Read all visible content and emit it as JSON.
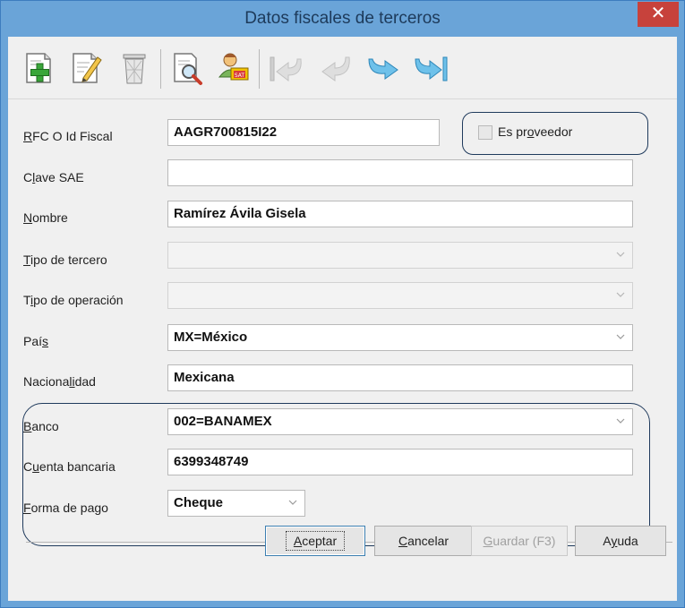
{
  "window": {
    "title": "Datos fiscales de terceros",
    "close_glyph": "✕"
  },
  "toolbar": {
    "buttons": [
      {
        "icon": "add-record-icon"
      },
      {
        "icon": "edit-record-icon"
      },
      {
        "icon": "delete-record-icon"
      },
      {
        "icon": "search-document-icon"
      },
      {
        "icon": "user-sat-icon"
      },
      {
        "icon": "first-record-icon"
      },
      {
        "icon": "previous-record-icon"
      },
      {
        "icon": "next-record-icon"
      },
      {
        "icon": "last-record-icon"
      }
    ]
  },
  "form": {
    "rfc": {
      "label_pre": "",
      "label_u": "R",
      "label_post": "FC O Id Fiscal",
      "value": "AAGR700815I22"
    },
    "es_proveedor": {
      "label_pre": "Es pr",
      "label_u": "o",
      "label_post": "veedor",
      "checked": false
    },
    "clave_sae": {
      "label_pre": "C",
      "label_u": "l",
      "label_post": "ave SAE",
      "value": ""
    },
    "nombre": {
      "label_pre": "",
      "label_u": "N",
      "label_post": "ombre",
      "value": "Ramírez Ávila Gisela"
    },
    "tipo_tercero": {
      "label_pre": "",
      "label_u": "T",
      "label_post": "ipo de tercero",
      "value": ""
    },
    "tipo_operacion": {
      "label_pre": "T",
      "label_u": "i",
      "label_post": "po de operación",
      "value": ""
    },
    "pais": {
      "label_pre": "Paí",
      "label_u": "s",
      "label_post": "",
      "value": "MX=México"
    },
    "nacionalidad": {
      "label_pre": "Naciona",
      "label_u": "li",
      "label_post": "dad",
      "value": "Mexicana"
    },
    "banco": {
      "label_pre": "",
      "label_u": "B",
      "label_post": "anco",
      "value": "002=BANAMEX"
    },
    "cuenta": {
      "label_pre": "C",
      "label_u": "u",
      "label_post": "enta bancaria",
      "value": "6399348749"
    },
    "forma_pago": {
      "label_pre": "",
      "label_u": "F",
      "label_post": "orma de pago",
      "value": "Cheque"
    }
  },
  "buttons": {
    "aceptar": {
      "pre": "",
      "u": "A",
      "post": "ceptar"
    },
    "cancelar": {
      "pre": "",
      "u": "C",
      "post": "ancelar"
    },
    "guardar": {
      "pre": "",
      "u": "G",
      "post": "uardar (F3)"
    },
    "ayuda": {
      "pre": "A",
      "u": "y",
      "post": "uda"
    }
  },
  "colors": {
    "titlebar": "#6aa4d8",
    "close": "#c7423c",
    "group_border": "#1f3a5c"
  }
}
